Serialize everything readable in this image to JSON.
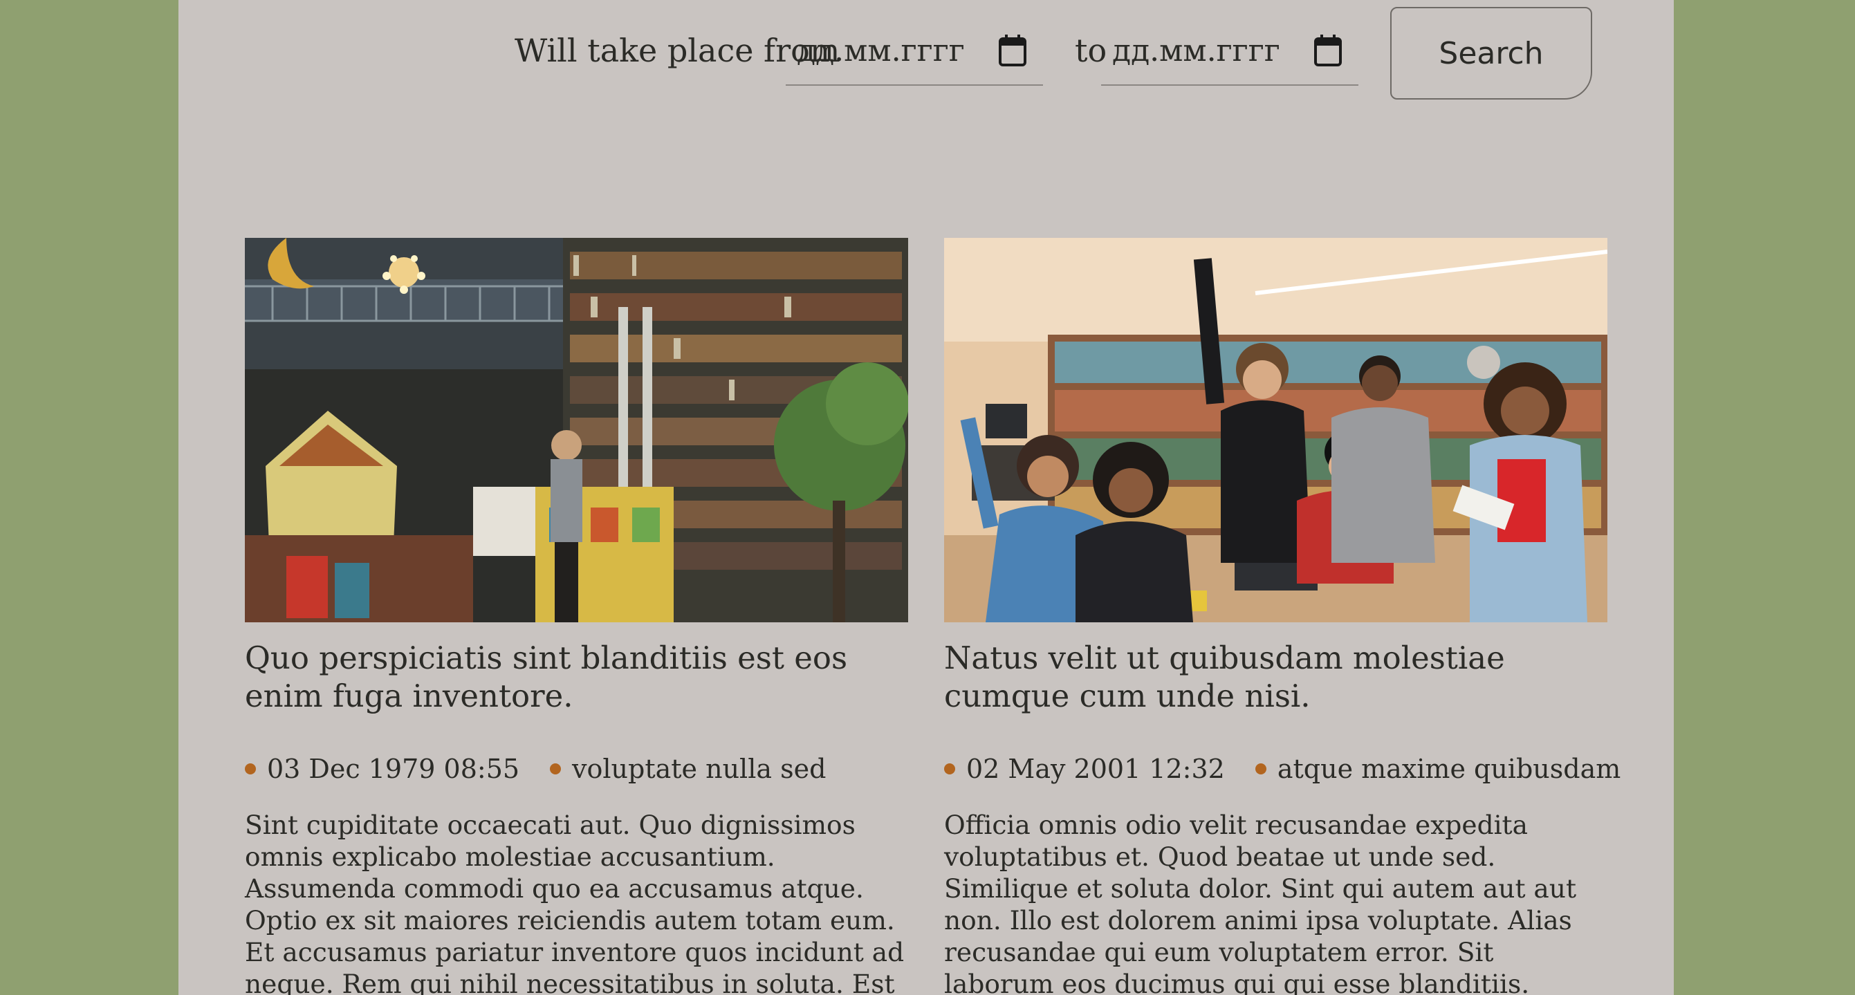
{
  "filter": {
    "label_from": "Will take place from",
    "date_from_placeholder": "дд.мм.гггг",
    "label_to": "to",
    "date_to_placeholder": "дд.мм.гггг",
    "search_label": "Search"
  },
  "cards": [
    {
      "title": "Quo perspiciatis sint blanditiis est eos enim fuga inventore.",
      "date": "03 Dec 1979 08:55",
      "location": "voluptate nulla sed",
      "excerpt": "Sint cupiditate occaecati aut. Quo dignissimos omnis explicabo molestiae accusantium. Assumenda commodi quo ea accusamus atque. Optio ex sit maiores reiciendis autem totam eum. Et accusamus pariatur inventore quos incidunt ad neque. Rem qui nihil necessitatibus in soluta. Est repudiandae aut magnam ..."
    },
    {
      "title": "Natus velit ut quibusdam molestiae cumque cum unde nisi.",
      "date": "02 May 2001 12:32",
      "location": "atque maxime quibusdam",
      "excerpt": "Officia omnis odio velit recusandae expedita voluptatibus et. Quod beatae ut unde sed. Similique et soluta dolor. Sint qui autem aut aut non. Illo est dolorem animi ipsa voluptate. Alias recusandae qui eum voluptatem error. Sit laborum eos ducimus qui qui esse blanditiis. Magnam voluptas incidunt ip..."
    }
  ],
  "colors": {
    "background_outer": "#8fa070",
    "background_page": "#c9c4c1",
    "meta_dot": "#b2651f",
    "text": "#2b2b27"
  },
  "icons": {
    "date_picker": "calendar-icon"
  }
}
